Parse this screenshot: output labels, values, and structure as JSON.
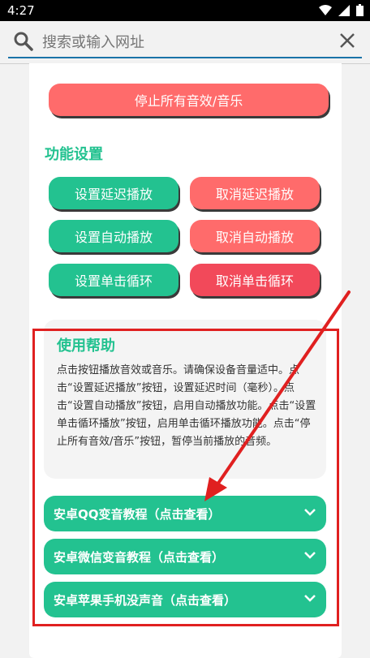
{
  "status": {
    "time": "4:27"
  },
  "search": {
    "placeholder": "搜索或输入网址"
  },
  "main": {
    "stop_all_label": "停止所有音效/音乐",
    "section_title": "功能设置",
    "buttons": [
      {
        "label": "设置延迟播放"
      },
      {
        "label": "取消延迟播放"
      },
      {
        "label": "设置自动播放"
      },
      {
        "label": "取消自动播放"
      },
      {
        "label": "设置单击循环"
      },
      {
        "label": "取消单击循环"
      }
    ]
  },
  "help": {
    "title": "使用帮助",
    "text": "点击按钮播放音效或音乐。请确保设备音量适中。点击“设置延迟播放”按钮，设置延迟时间（毫秒）。点击“设置自动播放”按钮，启用自动播放功能。点击“设置单击循环播放”按钮，启用单击循环播放功能。点击“停止所有音效/音乐”按钮，暂停当前播放的音频。"
  },
  "accordion": [
    {
      "label": "安卓QQ变音教程（点击查看）"
    },
    {
      "label": "安卓微信变音教程（点击查看）"
    },
    {
      "label": "安卓苹果手机没声音（点击查看）"
    }
  ],
  "colors": {
    "accent_green": "#23c290",
    "accent_red": "#ff6b6b",
    "annotation_red": "#e02020"
  }
}
